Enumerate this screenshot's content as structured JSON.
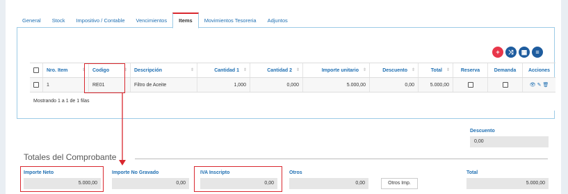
{
  "tabs": [
    {
      "label": "General"
    },
    {
      "label": "Stock"
    },
    {
      "label": "Impositivo / Contable"
    },
    {
      "label": "Vencimientos"
    },
    {
      "label": "Items"
    },
    {
      "label": "Movimientos Tesoreria"
    },
    {
      "label": "Adjuntos"
    }
  ],
  "active_tab": "Items",
  "toolbar": {
    "add_icon": "plus-icon",
    "shuffle_icon": "shuffle-icon",
    "table_icon": "table-icon",
    "list_icon": "list-icon"
  },
  "table": {
    "headers": [
      "Nro. Item",
      "Codigo",
      "Descripción",
      "Cantidad 1",
      "Cantidad 2",
      "Importe unitario",
      "Descuento",
      "Total",
      "Reserva",
      "Demanda",
      "Acciones"
    ],
    "rows": [
      {
        "nro": "1",
        "codigo": "RE01",
        "descripcion": "Filtro de Aceite",
        "cantidad1": "1,000",
        "cantidad2": "0,000",
        "importe_unitario": "5.000,00",
        "descuento": "0,00",
        "total": "5.000,00"
      }
    ],
    "footer": "Mostrando 1 a 1 de 1 filas"
  },
  "descuento": {
    "label": "Descuento",
    "value": "0,00"
  },
  "totales": {
    "title": "Totales del Comprobante",
    "importe_neto": {
      "label": "Importe Neto",
      "value": "5.000,00"
    },
    "importe_no_gravado": {
      "label": "Importe No Gravado",
      "value": "0,00"
    },
    "iva_inscripto": {
      "label": "IVA Inscripto",
      "value": "0,00"
    },
    "otros": {
      "label": "Otros",
      "value": "0,00"
    },
    "otros_imp_button": "Otros Imp.",
    "total": {
      "label": "Total",
      "value": "5.000,00"
    }
  },
  "colors": {
    "accent": "#1f6fb2",
    "highlight": "#d9272e",
    "add_button": "#e8364a",
    "toolbar_button": "#1e5c9e"
  }
}
